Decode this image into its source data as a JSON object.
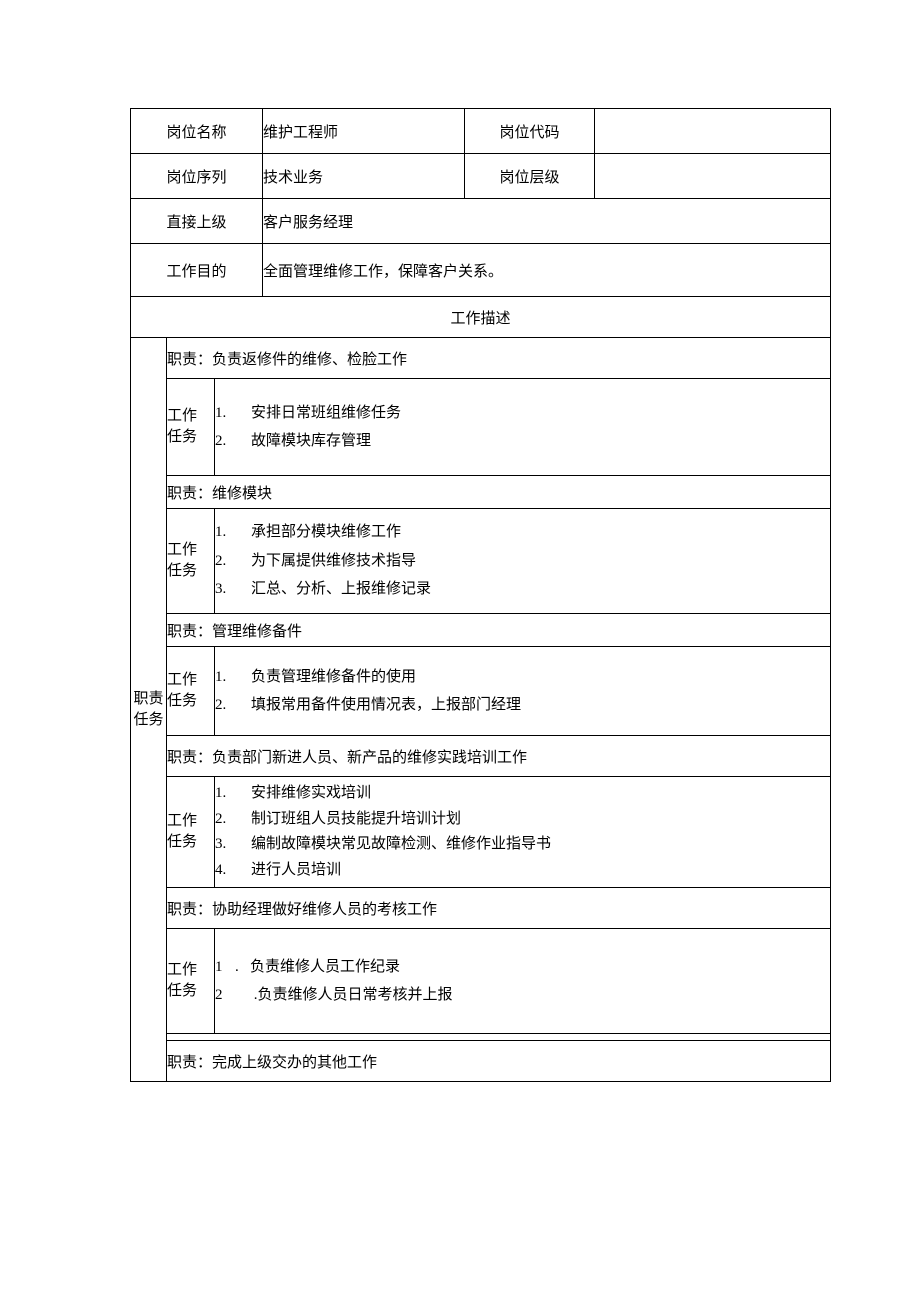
{
  "header": {
    "r1": {
      "l1": "岗位名称",
      "v1": "维护工程师",
      "l2": "岗位代码",
      "v2": ""
    },
    "r2": {
      "l1": "岗位序列",
      "v1": "技术业务",
      "l2": "岗位层级",
      "v2": ""
    },
    "r3": {
      "l1": "直接上级",
      "v1": "客户服务经理"
    },
    "r4": {
      "l1": "工作目的",
      "v1": "全面管理维修工作，保障客户关系。"
    }
  },
  "section_title": "工作描述",
  "side_label_1": "职责",
  "side_label_2": "任务",
  "task_label_1": "工作",
  "task_label_2": "任务",
  "duties": {
    "d1": {
      "title": "职责：负责返修件的维修、检脸工作",
      "n1": "1.",
      "t1": "安排日常班组维修任务",
      "n2": "2.",
      "t2": "故障模块库存管理"
    },
    "d2": {
      "title": "职责：维修模块",
      "n1": "1.",
      "t1": "承担部分模块维修工作",
      "n2": "2.",
      "t2": "为下属提供维修技术指导",
      "n3": "3.",
      "t3": "汇总、分析、上报维修记录"
    },
    "d3": {
      "title": "职责：管理维修备件",
      "n1": "1.",
      "t1": "负责管理维修备件的使用",
      "n2": "2.",
      "t2": "填报常用备件使用情况表，上报部门经理"
    },
    "d4": {
      "title": "职责：负责部门新进人员、新产品的维修实践培训工作",
      "n1": "1.",
      "t1": "安排维修实戏培训",
      "n2": "2.",
      "t2": "制订班组人员技能提升培训计划",
      "n3": "3.",
      "t3": "编制故障模块常见故障检测、维修作业指导书",
      "n4": "4.",
      "t4": "进行人员培训"
    },
    "d5": {
      "title": "职责：协助经理做好维修人员的考核工作",
      "n1": "1",
      "t1": ".   负责维修人员工作纪录",
      "n2": "2",
      "t2": "     .负责维修人员日常考核并上报"
    },
    "d6": {
      "title": "职责：完成上级交办的其他工作"
    }
  }
}
